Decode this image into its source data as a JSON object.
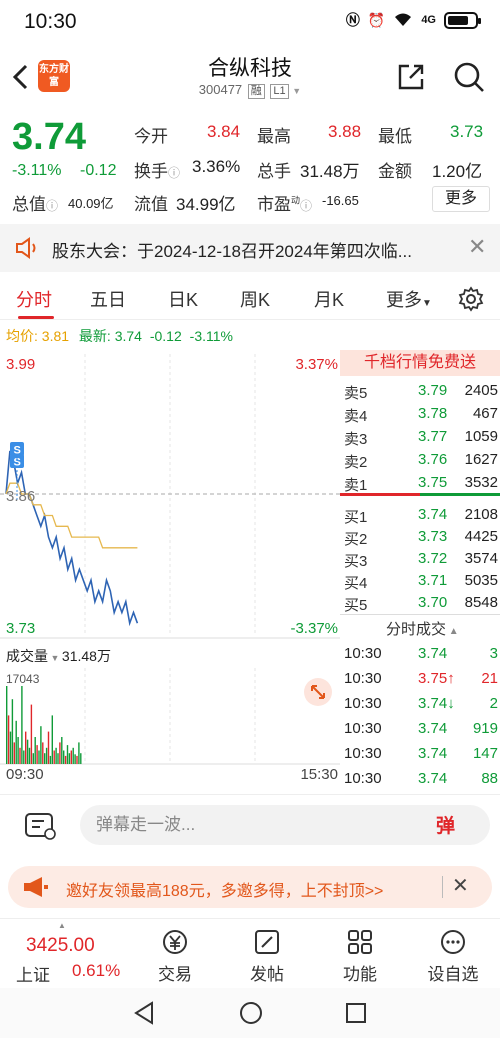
{
  "status_bar": {
    "time": "10:30",
    "network": "4G"
  },
  "header": {
    "app_logo_text": "东方财富",
    "stock_name": "合纵科技",
    "stock_code": "300477",
    "tag_margin": "融",
    "tag_level": "L1"
  },
  "quote": {
    "price": "3.74",
    "change_pct": "-3.11%",
    "change_abs": "-0.12",
    "open_label": "今开",
    "open_value": "3.84",
    "high_label": "最高",
    "high_value": "3.88",
    "low_label": "最低",
    "low_value": "3.73",
    "turnover_label": "换手",
    "turnover_value": "3.36%",
    "volume_label": "总手",
    "volume_value": "31.48万",
    "amount_label": "金额",
    "amount_value": "1.20亿",
    "total_cap_label": "总值",
    "total_cap_value": "40.09亿",
    "float_cap_label": "流值",
    "float_cap_value": "34.99亿",
    "pe_label": "市盈",
    "pe_sup": "动",
    "pe_value": "-16.65",
    "more_label": "更多"
  },
  "notice": {
    "text": "股东大会：于2024-12-18召开2024年第四次临..."
  },
  "tabs": [
    {
      "label": "分时"
    },
    {
      "label": "五日"
    },
    {
      "label": "日K"
    },
    {
      "label": "周K"
    },
    {
      "label": "月K"
    },
    {
      "label": "更多"
    }
  ],
  "avg_row": {
    "avg_label": "均价:",
    "avg_value": "3.81",
    "latest_label": "最新:",
    "latest_value": "3.74",
    "latest_chg": "-0.12",
    "latest_pct": "-3.11%"
  },
  "chart_data": {
    "type": "line",
    "title": "",
    "xlabel": "",
    "ylabel": "",
    "x_start": "09:30",
    "x_end": "15:30",
    "y_top_label": "3.99",
    "y_mid_label": "3.86",
    "y_bottom_label": "3.73",
    "pct_top_label": "3.37%",
    "pct_bottom_label": "-3.37%",
    "ylim": [
      3.73,
      3.99
    ],
    "prev_close": 3.86,
    "series": [
      {
        "values": [
          3.86,
          3.9,
          3.89,
          3.87,
          3.88,
          3.86,
          3.86,
          3.85,
          3.84,
          3.83,
          3.84,
          3.82,
          3.81,
          3.82,
          3.8,
          3.81,
          3.79,
          3.8,
          3.78,
          3.79,
          3.78,
          3.77,
          3.78,
          3.76,
          3.77,
          3.76,
          3.78,
          3.77,
          3.75,
          3.76,
          3.75,
          3.76,
          3.74,
          3.75,
          3.74
        ]
      },
      {
        "values": [
          3.86,
          3.87,
          3.87,
          3.87,
          3.86,
          3.86,
          3.86,
          3.85,
          3.85,
          3.85,
          3.84,
          3.84,
          3.84,
          3.83,
          3.83,
          3.83,
          3.83,
          3.82,
          3.82,
          3.82,
          3.82,
          3.82,
          3.82,
          3.82,
          3.82,
          3.81,
          3.81,
          3.81,
          3.81,
          3.81,
          3.81,
          3.81,
          3.81,
          3.81,
          3.81
        ]
      }
    ],
    "markers": [
      {
        "label": "S"
      },
      {
        "label": "S"
      }
    ]
  },
  "volume_panel": {
    "label": "成交量",
    "total": "31.48万",
    "max_label": "17043",
    "time_start": "09:30",
    "time_end": "15:30",
    "bars": [
      17043,
      9000,
      6000,
      12000,
      4000,
      8000,
      5000,
      3000,
      15000,
      2500,
      6000,
      4500,
      3000,
      11000,
      2000,
      5000,
      3500,
      2500,
      7000,
      4000,
      2000,
      3000,
      6000,
      1500,
      9000,
      2500,
      3000,
      2000,
      4000,
      5000,
      2500,
      1500,
      3500,
      2000,
      2500,
      3000,
      1800,
      1500,
      4000,
      2000
    ]
  },
  "orderbook": {
    "header": "千档行情免费送",
    "asks": [
      {
        "label": "卖5",
        "price": "3.79",
        "vol": "2405"
      },
      {
        "label": "卖4",
        "price": "3.78",
        "vol": "467"
      },
      {
        "label": "卖3",
        "price": "3.77",
        "vol": "1059"
      },
      {
        "label": "卖2",
        "price": "3.76",
        "vol": "1627"
      },
      {
        "label": "卖1",
        "price": "3.75",
        "vol": "3532"
      }
    ],
    "bids": [
      {
        "label": "买1",
        "price": "3.74",
        "vol": "2108"
      },
      {
        "label": "买2",
        "price": "3.73",
        "vol": "4425"
      },
      {
        "label": "买3",
        "price": "3.72",
        "vol": "3574"
      },
      {
        "label": "买4",
        "price": "3.71",
        "vol": "5035"
      },
      {
        "label": "买5",
        "price": "3.70",
        "vol": "8548"
      }
    ],
    "trades_header": "分时成交",
    "trades": [
      {
        "time": "10:30",
        "price": "3.74",
        "vol": "3",
        "arrow": ""
      },
      {
        "time": "10:30",
        "price": "3.75",
        "vol": "21",
        "arrow": "↑"
      },
      {
        "time": "10:30",
        "price": "3.74",
        "vol": "2",
        "arrow": "↓"
      },
      {
        "time": "10:30",
        "price": "3.74",
        "vol": "919",
        "arrow": ""
      },
      {
        "time": "10:30",
        "price": "3.74",
        "vol": "147",
        "arrow": ""
      },
      {
        "time": "10:30",
        "price": "3.74",
        "vol": "88",
        "arrow": ""
      }
    ]
  },
  "comment_bar": {
    "placeholder": "弹幕走一波...",
    "danmu_label": "弹"
  },
  "promo": {
    "text": "邀好友领最高188元，多邀多得，上不封顶>>"
  },
  "bottom_nav": {
    "index_value": "3425.00",
    "index_name": "上证",
    "index_pct": "0.61%",
    "items": [
      {
        "label": "交易"
      },
      {
        "label": "发帖"
      },
      {
        "label": "功能"
      },
      {
        "label": "设自选"
      }
    ]
  },
  "colors": {
    "up": "#e0262a",
    "down": "#0f9b38",
    "price_line": "#2e64b4",
    "avg_line": "#e6b84e",
    "accent": "#f05a22"
  }
}
